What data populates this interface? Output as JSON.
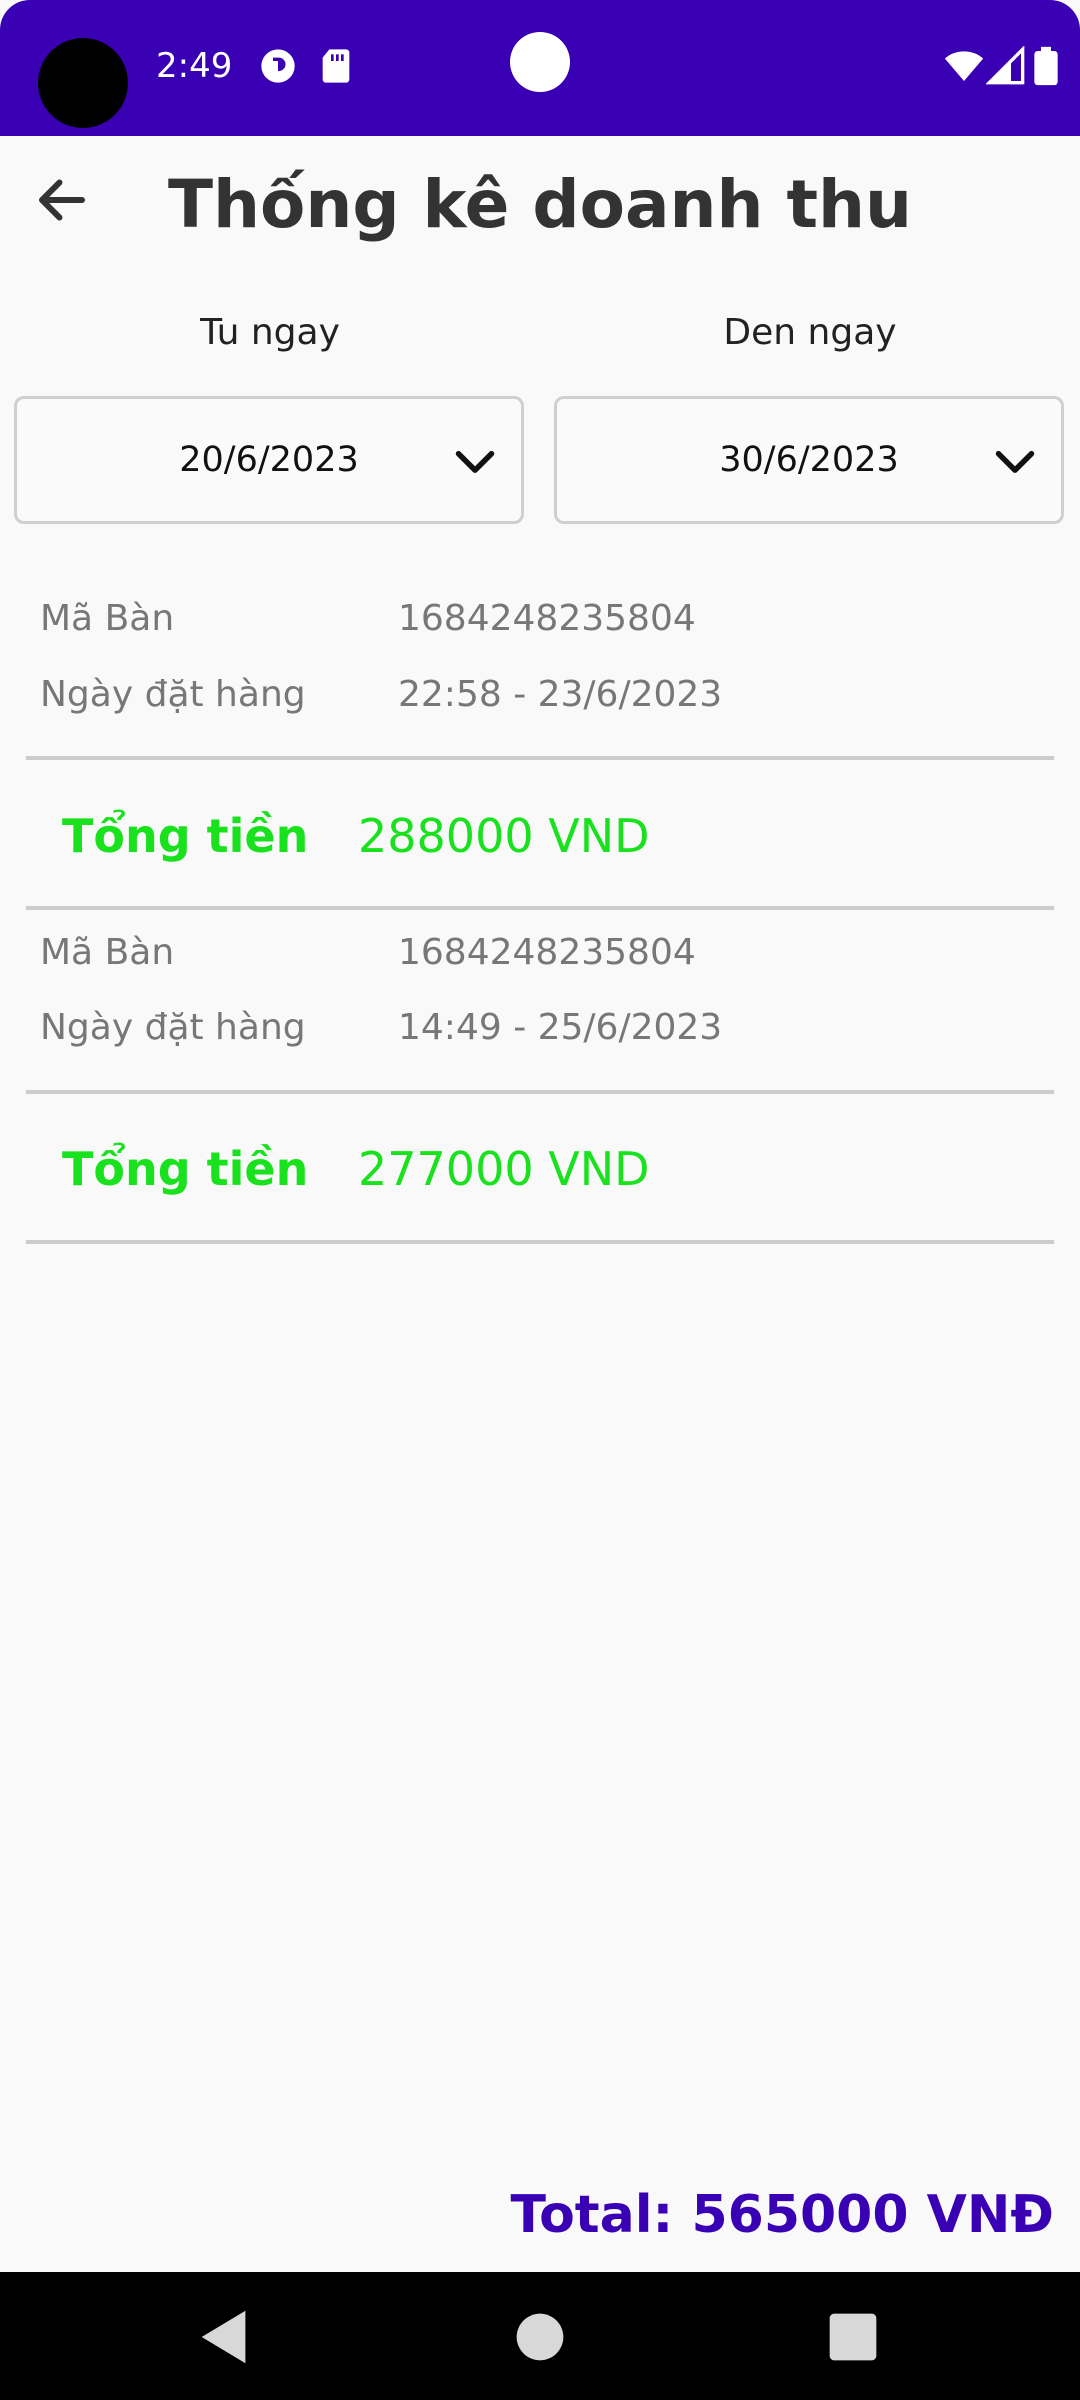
{
  "status_bar": {
    "time": "2:49",
    "background_color": "#3a00b4",
    "icons": [
      "cast-icon",
      "sd-card-icon",
      "wifi-icon",
      "signal-icon",
      "battery-icon"
    ]
  },
  "header": {
    "title": "Thống kê doanh thu",
    "back_icon": "arrow-left-icon"
  },
  "date_range": {
    "from_label": "Tu ngay",
    "to_label": "Den ngay",
    "from_value": "20/6/2023",
    "to_value": "30/6/2023"
  },
  "orders": [
    {
      "table_label": "Mã Bàn",
      "table_value": "1684248235804",
      "date_label": "Ngày đặt hàng",
      "date_value": "22:58 - 23/6/2023",
      "total_label": "Tổng tiền",
      "total_value": "288000 VND"
    },
    {
      "table_label": "Mã Bàn",
      "table_value": "1684248235804",
      "date_label": "Ngày đặt hàng",
      "date_value": "14:49 - 25/6/2023",
      "total_label": "Tổng tiền",
      "total_value": "277000 VND"
    }
  ],
  "summary": {
    "grand_total": "Total: 565000 VNĐ",
    "accent_color": "#3a00b4",
    "total_color": "#19e11d"
  },
  "nav_bar": {
    "icons": [
      "back-triangle-icon",
      "home-circle-icon",
      "recents-square-icon"
    ]
  }
}
